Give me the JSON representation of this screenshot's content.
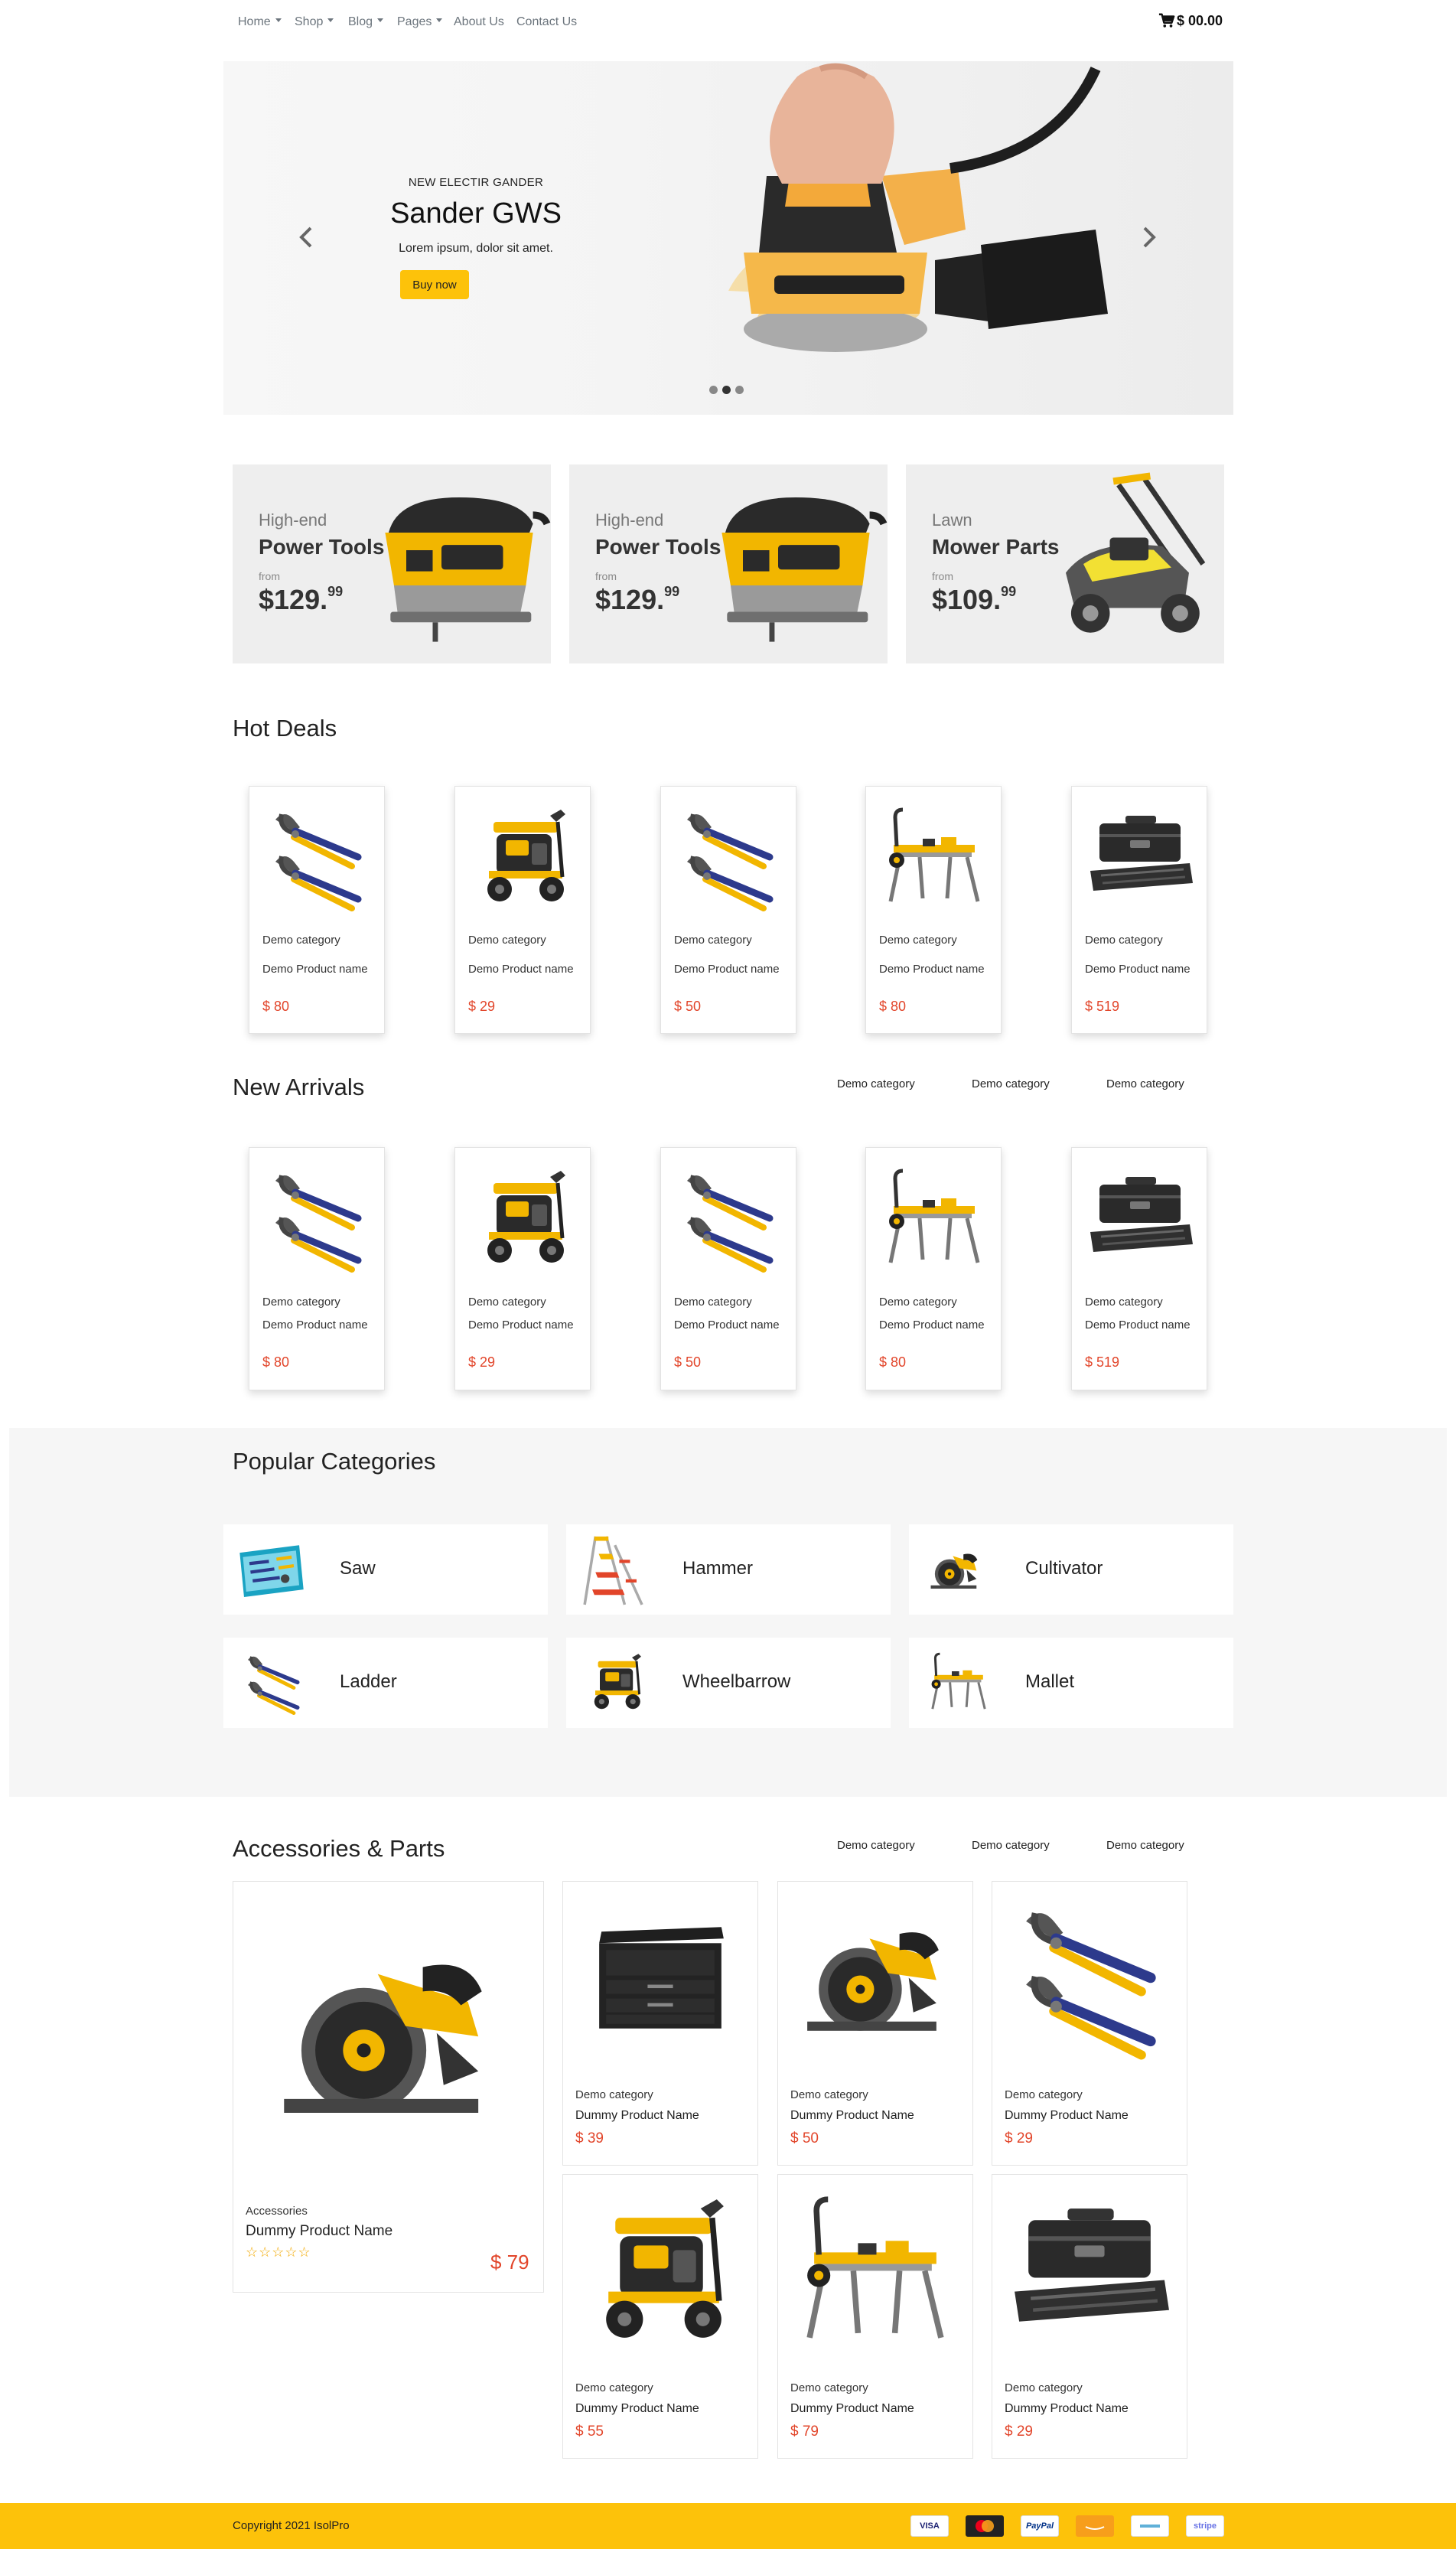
{
  "nav": {
    "items": [
      {
        "label": "Home",
        "dropdown": true
      },
      {
        "label": "Shop",
        "dropdown": true
      },
      {
        "label": "Blog",
        "dropdown": true
      },
      {
        "label": "Pages",
        "dropdown": true
      },
      {
        "label": "About Us",
        "dropdown": false
      },
      {
        "label": "Contact Us",
        "dropdown": false
      }
    ],
    "cart_total": "$ 00.00"
  },
  "hero": {
    "kicker": "NEW ELECTIR GANDER",
    "title": "Sander GWS",
    "subtitle": "Lorem ipsum, dolor sit amet.",
    "button": "Buy now",
    "slides": 3,
    "active_slide": 2
  },
  "promos": [
    {
      "tag": "High-end",
      "title": "Power Tools",
      "from": "from",
      "price_main": "$129.",
      "price_cents": "99",
      "image": "jigsaw-image"
    },
    {
      "tag": "High-end",
      "title": "Power Tools",
      "from": "from",
      "price_main": "$129.",
      "price_cents": "99",
      "image": "jigsaw-image"
    },
    {
      "tag": "Lawn",
      "title": "Mower Parts",
      "from": "from",
      "price_main": "$109.",
      "price_cents": "99",
      "image": "lawn-mower-image"
    }
  ],
  "hot_deals": {
    "title": "Hot Deals",
    "products": [
      {
        "category": "Demo category",
        "name": "Demo Product name",
        "price": "$ 80",
        "image": "pliers"
      },
      {
        "category": "Demo category",
        "name": "Demo Product name",
        "price": "$ 29",
        "image": "pressure-washer"
      },
      {
        "category": "Demo category",
        "name": "Demo Product name",
        "price": "$ 50",
        "image": "pliers"
      },
      {
        "category": "Demo category",
        "name": "Demo Product name",
        "price": "$ 80",
        "image": "saw-stand"
      },
      {
        "category": "Demo category",
        "name": "Demo Product name",
        "price": "$ 519",
        "image": "toolbox"
      }
    ]
  },
  "new_arrivals": {
    "title": "New Arrivals",
    "filters": [
      "Demo category",
      "Demo category",
      "Demo category"
    ],
    "products": [
      {
        "category": "Demo category",
        "name": "Demo Product name",
        "price": "$ 80",
        "image": "pliers"
      },
      {
        "category": "Demo category",
        "name": "Demo Product name",
        "price": "$ 29",
        "image": "pressure-washer"
      },
      {
        "category": "Demo category",
        "name": "Demo Product name",
        "price": "$ 50",
        "image": "pliers"
      },
      {
        "category": "Demo category",
        "name": "Demo Product name",
        "price": "$ 80",
        "image": "saw-stand"
      },
      {
        "category": "Demo category",
        "name": "Demo Product name",
        "price": "$ 519",
        "image": "toolbox"
      }
    ]
  },
  "popular": {
    "title": "Popular Categories",
    "categories": [
      {
        "label": "Saw",
        "image": "tool-kit"
      },
      {
        "label": "Hammer",
        "image": "step-ladder"
      },
      {
        "label": "Cultivator",
        "image": "circular-saw"
      },
      {
        "label": "Ladder",
        "image": "pliers"
      },
      {
        "label": "Wheelbarrow",
        "image": "pressure-washer"
      },
      {
        "label": "Mallet",
        "image": "saw-stand"
      }
    ]
  },
  "accessories": {
    "title": "Accessories & Parts",
    "filters": [
      "Demo category",
      "Demo category",
      "Demo category"
    ],
    "featured": {
      "category": "Accessories",
      "name": "Dummy Product Name",
      "price": "$ 79",
      "rating": 0,
      "stars": "☆☆☆☆☆"
    },
    "products": [
      {
        "category": "Demo category",
        "name": "Dummy Product Name",
        "price": "$ 39",
        "image": "tool-chest"
      },
      {
        "category": "Demo category",
        "name": "Dummy Product Name",
        "price": "$ 50",
        "image": "circular-saw"
      },
      {
        "category": "Demo category",
        "name": "Dummy Product Name",
        "price": "$ 29",
        "image": "pliers"
      },
      {
        "category": "Demo category",
        "name": "Dummy Product Name",
        "price": "$ 55",
        "image": "pressure-washer"
      },
      {
        "category": "Demo category",
        "name": "Dummy Product Name",
        "price": "$ 79",
        "image": "saw-stand"
      },
      {
        "category": "Demo category",
        "name": "Dummy Product Name",
        "price": "$ 29",
        "image": "toolbox"
      }
    ]
  },
  "footer": {
    "copyright": "Copyright 2021 IsolPro",
    "payments": [
      "VISA",
      "",
      "PayPal",
      "",
      "",
      "stripe"
    ]
  },
  "colors": {
    "accent": "#fdc20a",
    "price": "#e2452a"
  }
}
